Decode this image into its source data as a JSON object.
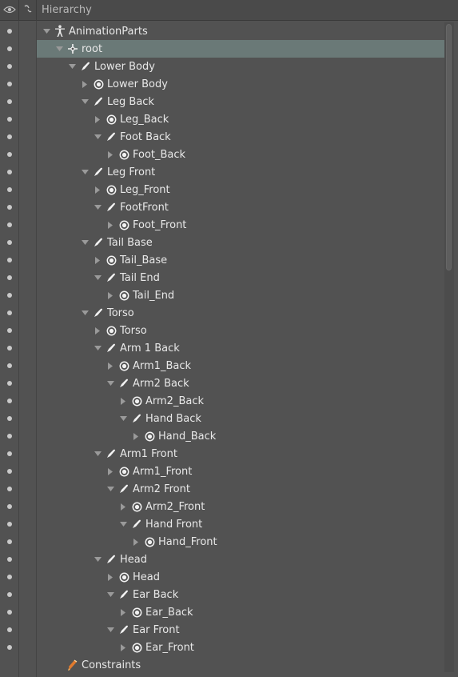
{
  "header": {
    "title": "Hierarchy"
  },
  "tree": [
    {
      "label": "AnimationParts",
      "depth": 0,
      "icon": "figure-icon",
      "arrow": "down",
      "selected": false
    },
    {
      "label": "root",
      "depth": 1,
      "icon": "move-cross-icon",
      "arrow": "down",
      "selected": true
    },
    {
      "label": "Lower Body",
      "depth": 2,
      "icon": "bone-icon",
      "arrow": "down"
    },
    {
      "label": "Lower Body",
      "depth": 3,
      "icon": "slot-icon",
      "arrow": "right"
    },
    {
      "label": "Leg Back",
      "depth": 3,
      "icon": "bone-icon",
      "arrow": "down"
    },
    {
      "label": "Leg_Back",
      "depth": 4,
      "icon": "slot-icon",
      "arrow": "right"
    },
    {
      "label": "Foot Back",
      "depth": 4,
      "icon": "bone-icon",
      "arrow": "down"
    },
    {
      "label": "Foot_Back",
      "depth": 5,
      "icon": "slot-icon",
      "arrow": "right"
    },
    {
      "label": "Leg Front",
      "depth": 3,
      "icon": "bone-icon",
      "arrow": "down"
    },
    {
      "label": "Leg_Front",
      "depth": 4,
      "icon": "slot-icon",
      "arrow": "right"
    },
    {
      "label": "FootFront",
      "depth": 4,
      "icon": "bone-icon",
      "arrow": "down"
    },
    {
      "label": "Foot_Front",
      "depth": 5,
      "icon": "slot-icon",
      "arrow": "right"
    },
    {
      "label": "Tail Base",
      "depth": 3,
      "icon": "bone-icon",
      "arrow": "down"
    },
    {
      "label": "Tail_Base",
      "depth": 4,
      "icon": "slot-icon",
      "arrow": "right"
    },
    {
      "label": "Tail End",
      "depth": 4,
      "icon": "bone-icon",
      "arrow": "down"
    },
    {
      "label": "Tail_End",
      "depth": 5,
      "icon": "slot-icon",
      "arrow": "right"
    },
    {
      "label": "Torso",
      "depth": 3,
      "icon": "bone-icon",
      "arrow": "down"
    },
    {
      "label": "Torso",
      "depth": 4,
      "icon": "slot-icon",
      "arrow": "right"
    },
    {
      "label": "Arm 1 Back",
      "depth": 4,
      "icon": "bone-icon",
      "arrow": "down"
    },
    {
      "label": "Arm1_Back",
      "depth": 5,
      "icon": "slot-icon",
      "arrow": "right"
    },
    {
      "label": "Arm2 Back",
      "depth": 5,
      "icon": "bone-icon",
      "arrow": "down"
    },
    {
      "label": "Arm2_Back",
      "depth": 6,
      "icon": "slot-icon",
      "arrow": "right"
    },
    {
      "label": "Hand Back",
      "depth": 6,
      "icon": "bone-icon",
      "arrow": "down"
    },
    {
      "label": "Hand_Back",
      "depth": 7,
      "icon": "slot-icon",
      "arrow": "right"
    },
    {
      "label": "Arm1 Front",
      "depth": 4,
      "icon": "bone-icon",
      "arrow": "down"
    },
    {
      "label": "Arm1_Front",
      "depth": 5,
      "icon": "slot-icon",
      "arrow": "right"
    },
    {
      "label": "Arm2 Front",
      "depth": 5,
      "icon": "bone-icon",
      "arrow": "down"
    },
    {
      "label": "Arm2_Front",
      "depth": 6,
      "icon": "slot-icon",
      "arrow": "right"
    },
    {
      "label": "Hand Front",
      "depth": 6,
      "icon": "bone-icon",
      "arrow": "down"
    },
    {
      "label": "Hand_Front",
      "depth": 7,
      "icon": "slot-icon",
      "arrow": "right"
    },
    {
      "label": "Head",
      "depth": 4,
      "icon": "bone-icon",
      "arrow": "down"
    },
    {
      "label": "Head",
      "depth": 5,
      "icon": "slot-icon",
      "arrow": "right"
    },
    {
      "label": "Ear Back",
      "depth": 5,
      "icon": "bone-icon",
      "arrow": "down"
    },
    {
      "label": "Ear_Back",
      "depth": 6,
      "icon": "slot-icon",
      "arrow": "right"
    },
    {
      "label": "Ear Front",
      "depth": 5,
      "icon": "bone-icon",
      "arrow": "down"
    },
    {
      "label": "Ear_Front",
      "depth": 6,
      "icon": "slot-icon",
      "arrow": "right"
    },
    {
      "label": "Constraints",
      "depth": 1,
      "icon": "constraint-icon",
      "arrow": "none",
      "noDot": true
    }
  ],
  "colors": {
    "selection": "#6a7977",
    "constraint": "#e07a2e",
    "bone": "#f2f2f2"
  }
}
